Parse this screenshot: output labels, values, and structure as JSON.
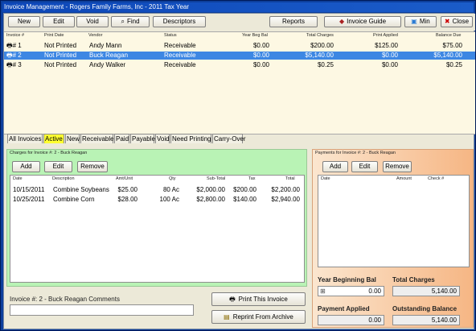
{
  "window": {
    "title": "Invoice Management - Rogers Family Farms, Inc - 2011 Tax Year"
  },
  "toolbar": {
    "new": "New",
    "edit": "Edit",
    "void": "Void",
    "find": "Find",
    "descriptors": "Descriptors",
    "reports": "Reports",
    "invoice_guide": "Invoice Guide",
    "min": "Min",
    "close": "Close"
  },
  "invoices": {
    "headers": {
      "invoice": "Invoice #",
      "print_date": "Print Date",
      "vendor": "Vendor",
      "status": "Status",
      "year_beg_bal": "Year Beg Bal",
      "total_charges": "Total Charges",
      "print_applied": "Print Applied",
      "balance_due": "Balance Due"
    },
    "rows": [
      {
        "invoice": "# 1",
        "print_date": "Not Printed",
        "vendor": "Andy Mann",
        "status": "Receivable",
        "year_beg_bal": "$0.00",
        "total_charges": "$200.00",
        "print_applied": "$125.00",
        "balance_due": "$75.00"
      },
      {
        "invoice": "# 2",
        "print_date": "Not Printed",
        "vendor": "Buck Reagan",
        "status": "Receivable",
        "year_beg_bal": "$0.00",
        "total_charges": "$5,140.00",
        "print_applied": "$0.00",
        "balance_due": "$5,140.00"
      },
      {
        "invoice": "# 3",
        "print_date": "Not Printed",
        "vendor": "Andy Walker",
        "status": "Receivable",
        "year_beg_bal": "$0.00",
        "total_charges": "$0.25",
        "print_applied": "$0.00",
        "balance_due": "$0.25"
      }
    ]
  },
  "tabs": [
    "All Invoices",
    "Active",
    "New",
    "Receivable",
    "Paid",
    "Payable",
    "Void",
    "Need Printing",
    "Carry-Over"
  ],
  "charges": {
    "title": "Charges for Invoice #: 2 - Buck Reagan",
    "add": "Add",
    "edit": "Edit",
    "remove": "Remove",
    "headers": {
      "date": "Date",
      "description": "Description",
      "amt_unit": "Amt/Unit",
      "qty": "Qty",
      "subtotal": "Sub-Total",
      "tax": "Tax",
      "total": "Total"
    },
    "rows": [
      {
        "date": "10/15/2011",
        "description": "Combine Soybeans",
        "amt_unit": "$25.00",
        "qty": "80 Ac",
        "subtotal": "$2,000.00",
        "tax": "$200.00",
        "total": "$2,200.00"
      },
      {
        "date": "10/25/2011",
        "description": "Combine Corn",
        "amt_unit": "$28.00",
        "qty": "100 Ac",
        "subtotal": "$2,800.00",
        "tax": "$140.00",
        "total": "$2,940.00"
      }
    ]
  },
  "payments": {
    "title": "Payments for Invoice #: 2 - Buck Reagan",
    "add": "Add",
    "edit": "Edit",
    "remove": "Remove",
    "headers": {
      "date": "Date",
      "amount": "Amount",
      "check": "Check #"
    }
  },
  "totals": {
    "year_beginning_bal_label": "Year Beginning Bal",
    "year_beginning_bal": "0.00",
    "total_charges_label": "Total Charges",
    "total_charges": "5,140.00",
    "payment_applied_label": "Payment Applied",
    "payment_applied": "0.00",
    "outstanding_balance_label": "Outstanding Balance",
    "outstanding_balance": "5,140.00"
  },
  "comments": {
    "label": "Invoice #: 2 - Buck Reagan Comments"
  },
  "actions": {
    "print": "Print This Invoice",
    "reprint": "Reprint From Archive"
  }
}
